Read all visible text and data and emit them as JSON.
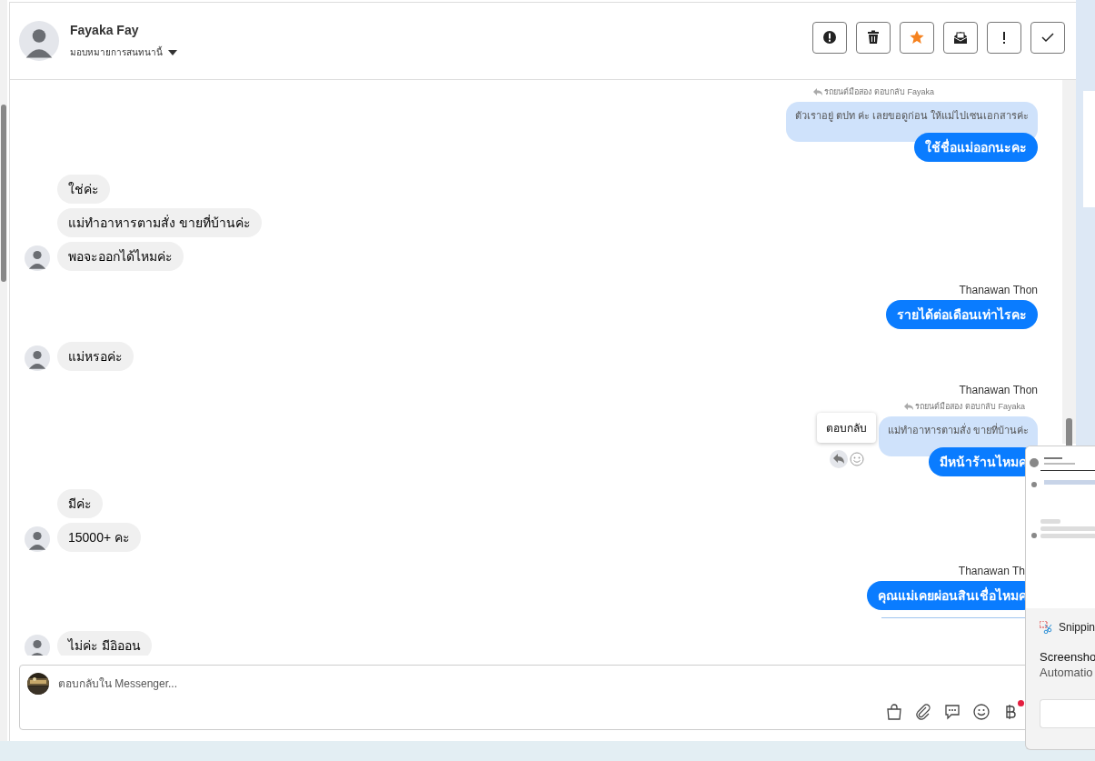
{
  "conversation": {
    "name": "Fayaka Fay",
    "assign_label": "มอบหมายการสนทนานี้"
  },
  "toolbar": [
    {
      "kind": "spam"
    },
    {
      "kind": "delete"
    },
    {
      "kind": "star",
      "on": true
    },
    {
      "kind": "unread"
    },
    {
      "kind": "important"
    },
    {
      "kind": "done"
    }
  ],
  "messages": [
    {
      "kind": "outgoing",
      "reply_label": "รถยนต์มือสอง ตอบกลับ Fayaka",
      "quoted": "ตัวเราอยู่ ตปท ค่ะ เลยขอดูก่อน ให้แม่ไปเซนเอกสารค่ะ",
      "bubbles": [
        "ใช้ชื่อแม่ออกนะคะ"
      ]
    },
    {
      "kind": "incoming",
      "bubbles": [
        "ใช่ค่ะ",
        "แม่ทำอาหารตามสั่ง ขายที่บ้านค่ะ",
        "พอจะออกได้ไหมค่ะ"
      ]
    },
    {
      "kind": "outgoing",
      "sender": "Thanawan Thon",
      "bubbles": [
        "รายได้ต่อเดือนเท่าไรคะ"
      ]
    },
    {
      "kind": "incoming",
      "bubbles": [
        "แม่หรอค่ะ"
      ]
    },
    {
      "kind": "outgoing",
      "sender": "Thanawan Thon",
      "reply_label": "รถยนต์มือสอง ตอบกลับ Fayaka",
      "quoted": "แม่ทำอาหารตามสั่ง ขายที่บ้านค่ะ",
      "bubbles": [
        "มีหน้าร้านไหมค"
      ],
      "hover_tooltip": "ตอบกลับ"
    },
    {
      "kind": "incoming",
      "bubbles": [
        "มีค่ะ",
        "15000+ คะ"
      ]
    },
    {
      "kind": "outgoing",
      "sender": "Thanawan Th",
      "bubbles": [
        "คุณแม่เคยผ่อนสินเชื่อไหมค"
      ],
      "divider": true
    },
    {
      "kind": "incoming",
      "bubbles": [
        "ไม่ค่ะ มีอิออน"
      ]
    }
  ],
  "composer": {
    "placeholder": "ตอบกลับใน Messenger...",
    "tools": [
      {
        "kind": "shop"
      },
      {
        "kind": "attach"
      },
      {
        "kind": "chat"
      },
      {
        "kind": "emoji"
      },
      {
        "kind": "payment",
        "badge": true
      }
    ]
  },
  "notification": {
    "app": "Snippin",
    "title": "Screensho",
    "body": "Automatio"
  }
}
